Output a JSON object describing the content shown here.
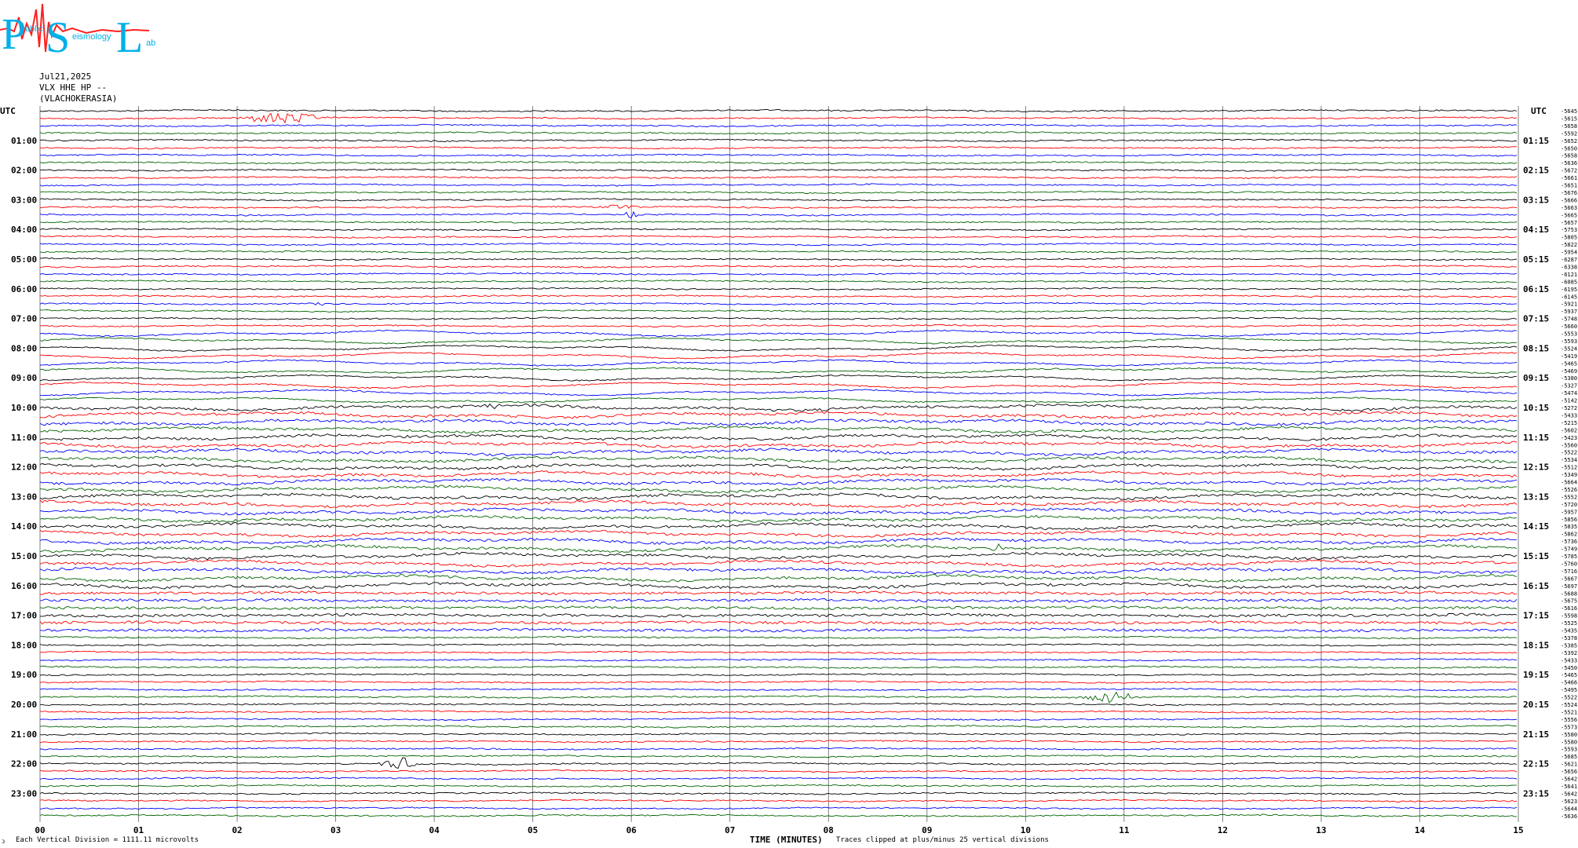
{
  "logo": {
    "big_letters": [
      "P",
      "S",
      "L"
    ],
    "small_text": [
      "ublic",
      "eismology",
      "ab"
    ]
  },
  "header": {
    "date": "Jul21,2025",
    "station": "VLX HHE HP --",
    "location": "(VLACHOKERASIA)"
  },
  "footer": {
    "corner": "ↄ",
    "scale_note": "Each Vertical Division = 1111.11 microvolts",
    "clip_note": "Traces clipped at plus/minus 25 vertical divisions"
  },
  "colors": {
    "trace_cycle": [
      "#000000",
      "#ff0000",
      "#0000ff",
      "#006400"
    ],
    "grid": "#606060",
    "logo": "#00b0e8",
    "logo_wave": "#ff2020"
  },
  "chart_data": {
    "type": "line",
    "xlabel": "TIME (MINUTES)",
    "xlim": [
      0,
      15
    ],
    "x_ticks": [
      "00",
      "01",
      "02",
      "03",
      "04",
      "05",
      "06",
      "07",
      "08",
      "09",
      "10",
      "11",
      "12",
      "13",
      "14",
      "15"
    ],
    "left_label_top": "UTC",
    "right_label_top": "UTC",
    "left_hour_labels": [
      "01:00",
      "02:00",
      "03:00",
      "04:00",
      "05:00",
      "06:00",
      "07:00",
      "08:00",
      "09:00",
      "10:00",
      "11:00",
      "12:00",
      "13:00",
      "14:00",
      "15:00",
      "16:00",
      "17:00",
      "18:00",
      "19:00",
      "20:00",
      "21:00",
      "22:00",
      "23:00"
    ],
    "right_hour_labels": [
      "01:15",
      "02:15",
      "03:15",
      "04:15",
      "05:15",
      "06:15",
      "07:15",
      "08:15",
      "09:15",
      "10:15",
      "11:15",
      "12:15",
      "13:15",
      "14:15",
      "15:15",
      "16:15",
      "17:15",
      "18:15",
      "19:15",
      "20:15",
      "21:15",
      "22:15",
      "23:15"
    ],
    "trace_count": 96,
    "trace_offsets": [
      "-5645",
      "-5615",
      "-5658",
      "-5592",
      "-5652",
      "-5650",
      "-5658",
      "-5636",
      "-5672",
      "-5661",
      "-5651",
      "-5676",
      "-5666",
      "-5663",
      "-5665",
      "-5657",
      "-5753",
      "-5805",
      "-5822",
      "-5954",
      "-6287",
      "-6338",
      "-6121",
      "-6085",
      "-6195",
      "-6145",
      "-5921",
      "-5937",
      "-5748",
      "-5660",
      "-5553",
      "-5593",
      "-5524",
      "-5419",
      "-5465",
      "-5469",
      "-5380",
      "-5327",
      "-5474",
      "-5142",
      "-5272",
      "-5433",
      "-5215",
      "-5602",
      "-5423",
      "-5560",
      "-5522",
      "-5534",
      "-5512",
      "-5349",
      "-5664",
      "-5526",
      "-5552",
      "-5720",
      "-5957",
      "-5856",
      "-5835",
      "-5862",
      "-5736",
      "-5749",
      "-5785",
      "-5760",
      "-5716",
      "-5667",
      "-5697",
      "-5688",
      "-5675",
      "-5616",
      "-5598",
      "-5525",
      "-5435",
      "-5378",
      "-5385",
      "-5392",
      "-5433",
      "-5450",
      "-5465",
      "-5466",
      "-5495",
      "-5522",
      "-5524",
      "-5521",
      "-5556",
      "-5573",
      "-5580",
      "-5580",
      "-5593",
      "-5685",
      "-5621",
      "-5656",
      "-5642",
      "-5641",
      "-5642",
      "-5623",
      "-5644",
      "-5636"
    ],
    "events": [
      {
        "trace": 1,
        "start_min": 1.9,
        "end_min": 3.0,
        "amplitude": "large"
      },
      {
        "trace": 13,
        "start_min": 5.5,
        "end_min": 6.2,
        "amplitude": "small"
      },
      {
        "trace": 14,
        "start_min": 5.9,
        "end_min": 6.1,
        "amplitude": "medium"
      },
      {
        "trace": 26,
        "start_min": 2.6,
        "end_min": 3.0,
        "amplitude": "small"
      },
      {
        "trace": 40,
        "start_min": 4.5,
        "end_min": 4.7,
        "amplitude": "medium"
      },
      {
        "trace": 59,
        "start_min": 9.6,
        "end_min": 9.8,
        "amplitude": "medium"
      },
      {
        "trace": 79,
        "start_min": 10.5,
        "end_min": 11.2,
        "amplitude": "large"
      },
      {
        "trace": 88,
        "start_min": 3.4,
        "end_min": 3.9,
        "amplitude": "large"
      }
    ]
  }
}
